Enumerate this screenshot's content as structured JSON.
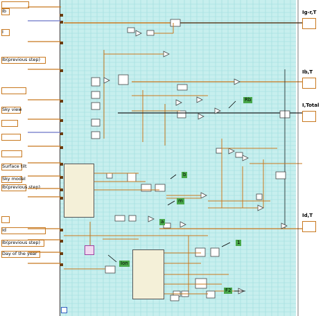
{
  "controls": [
    {
      "id": "c1",
      "label": ""
    },
    {
      "id": "c2",
      "label": "Ib"
    },
    {
      "id": "c3",
      "label": "I"
    },
    {
      "id": "c4",
      "label": "Ib(previous step)"
    },
    {
      "id": "c5",
      "label": ""
    },
    {
      "id": "c6",
      "label": "Sky view"
    },
    {
      "id": "c7",
      "label": ""
    },
    {
      "id": "c8",
      "label": ""
    },
    {
      "id": "c9",
      "label": ""
    },
    {
      "id": "c10",
      "label": "Surface tilt"
    },
    {
      "id": "c11",
      "label": "Sky model"
    },
    {
      "id": "c12",
      "label": "Ib(previous step)"
    },
    {
      "id": "c13",
      "label": ""
    },
    {
      "id": "c14",
      "label": "Id"
    },
    {
      "id": "c15",
      "label": "Ib(previous step)"
    },
    {
      "id": "c16",
      "label": "Day of the year"
    }
  ],
  "indicators": [
    {
      "id": "i1",
      "label": "Ig-r,T"
    },
    {
      "id": "i2",
      "label": "Ib,T"
    },
    {
      "id": "i3",
      "label": "I,Total"
    },
    {
      "id": "i4",
      "label": "Id,T"
    }
  ],
  "tags": [
    {
      "id": "t1",
      "text": "Rb"
    },
    {
      "id": "t2",
      "text": "b"
    },
    {
      "id": "t3",
      "text": "m"
    },
    {
      "id": "t4",
      "text": "a"
    },
    {
      "id": "t5",
      "text": "1"
    },
    {
      "id": "t6",
      "text": "Ion"
    },
    {
      "id": "t7",
      "text": "F2"
    }
  ],
  "colors": {
    "panel": "#c7efee",
    "grid": "#8fd6d8",
    "wire": "#c8781e",
    "wire_blue": "#6a75c8",
    "dark": "#222222"
  }
}
